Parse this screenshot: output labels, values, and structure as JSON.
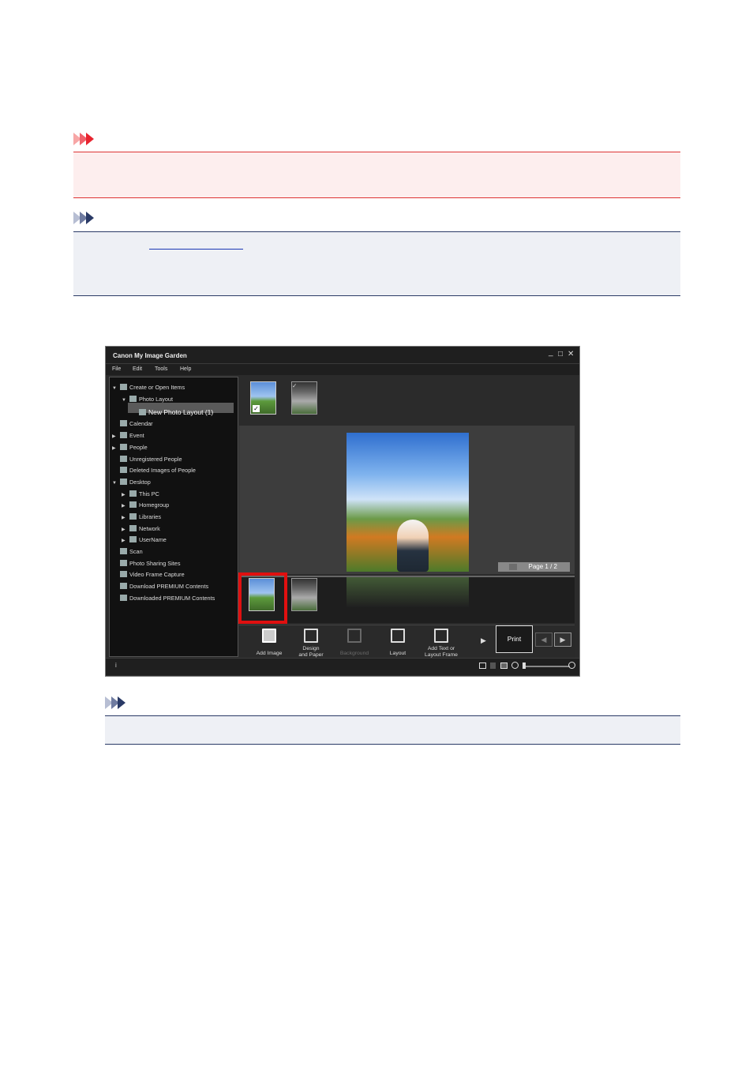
{
  "important_header_colors": {
    "chevron": "#e8242f",
    "box_border": "#dd3333"
  },
  "note_header_colors": {
    "chevron": "#2a3a66",
    "box_border": "#2a3a66"
  },
  "app": {
    "title": "Canon My Image Garden",
    "window_controls": [
      "_",
      "□",
      "✕"
    ],
    "menu": [
      "File",
      "Edit",
      "Tools",
      "Help"
    ],
    "tree": [
      {
        "label": "Create or Open Items",
        "arrow": "▼",
        "icon": "create-icon",
        "level": 0
      },
      {
        "label": "Photo Layout",
        "arrow": "▼",
        "icon": "photo-layout-icon",
        "level": 1
      },
      {
        "label": "New Photo Layout (1)",
        "arrow": "",
        "icon": "layout-grid-icon",
        "level": 2,
        "selected": true
      },
      {
        "label": "Calendar",
        "arrow": "",
        "icon": "calendar-icon",
        "level": 0
      },
      {
        "label": "Event",
        "arrow": "▶",
        "icon": "event-icon",
        "level": 0
      },
      {
        "label": "People",
        "arrow": "▶",
        "icon": "people-icon",
        "level": 0
      },
      {
        "label": "Unregistered People",
        "arrow": "",
        "icon": "unregistered-people-icon",
        "level": 0
      },
      {
        "label": "Deleted Images of People",
        "arrow": "",
        "icon": "deleted-people-icon",
        "level": 0
      },
      {
        "label": "Desktop",
        "arrow": "▼",
        "icon": "desktop-icon",
        "level": 0
      },
      {
        "label": "This PC",
        "arrow": "▶",
        "icon": "this-pc-icon",
        "level": 1
      },
      {
        "label": "Homegroup",
        "arrow": "▶",
        "icon": "homegroup-icon",
        "level": 1
      },
      {
        "label": "Libraries",
        "arrow": "▶",
        "icon": "libraries-icon",
        "level": 1
      },
      {
        "label": "Network",
        "arrow": "▶",
        "icon": "network-icon",
        "level": 1
      },
      {
        "label": "UserName",
        "arrow": "▶",
        "icon": "user-folder-icon",
        "level": 1
      },
      {
        "label": "Scan",
        "arrow": "",
        "icon": "scan-icon",
        "level": 0
      },
      {
        "label": "Photo Sharing Sites",
        "arrow": "",
        "icon": "photo-sharing-icon",
        "level": 0
      },
      {
        "label": "Video Frame Capture",
        "arrow": "",
        "icon": "video-capture-icon",
        "level": 0
      },
      {
        "label": "Download PREMIUM Contents",
        "arrow": "",
        "icon": "download-premium-icon",
        "level": 0
      },
      {
        "label": "Downloaded PREMIUM Contents",
        "arrow": "",
        "icon": "downloaded-premium-icon",
        "level": 0
      }
    ],
    "page_indicator": "Page 1 / 2",
    "tools": [
      {
        "label": "Add Image",
        "selected": true
      },
      {
        "label": "Design and Paper"
      },
      {
        "label": "Background",
        "disabled": true
      },
      {
        "label": "Layout"
      },
      {
        "label": "Add Text or Layout Frame"
      }
    ],
    "more_arrow": "▶",
    "print_label": "Print",
    "nav_prev": "◀",
    "nav_next": "▶",
    "info_glyph": "i",
    "highlight_color": "#e01010"
  }
}
